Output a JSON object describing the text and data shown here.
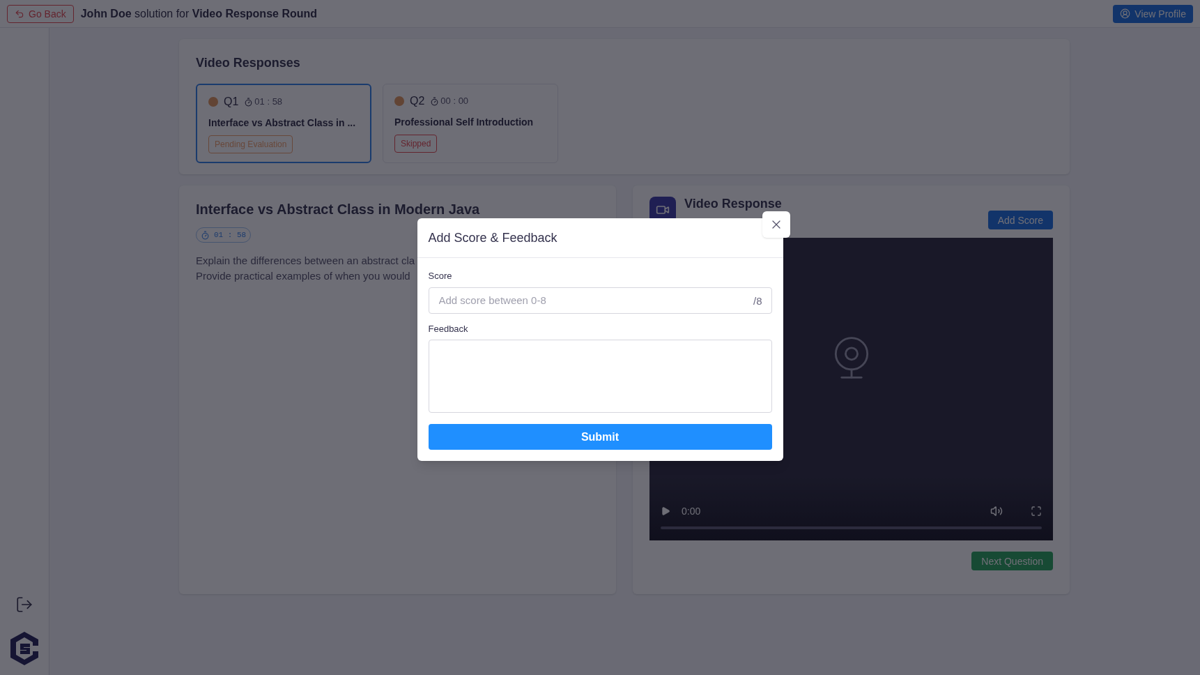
{
  "header": {
    "back_button": "Go Back",
    "title": "**John Doe** solution for **Video Response Round**",
    "profile_button": "View Profile"
  },
  "responses": {
    "title": "Video Responses",
    "items": [
      {
        "number": "Q1",
        "time": "01 : 58",
        "title": "Interface vs Abstract Class in ...",
        "status": "Pending Evaluation",
        "kind": "pending",
        "selected": true
      },
      {
        "number": "Q2",
        "time": "00 : 00",
        "title": "Professional Self Introduction",
        "status": "Skipped",
        "kind": "skipped",
        "selected": false
      }
    ]
  },
  "question": {
    "title": "Interface vs Abstract Class in Modern Java",
    "time": "01 : 58",
    "description_lines": [
      "Explain the differences between an abstract cla",
      "Provide practical examples of when you would"
    ]
  },
  "video": {
    "title": "Video Response",
    "add_score_button": "Add Score",
    "current_time": "0:00",
    "level": 0,
    "next_button": "Next Question"
  },
  "modal": {
    "title": "Add Score & Feedback",
    "score_label": "Score",
    "score_placeholder": "Add score between 0-8",
    "score_suffix": "/8",
    "feedback_label": "Feedback",
    "submit_button": "Submit"
  }
}
